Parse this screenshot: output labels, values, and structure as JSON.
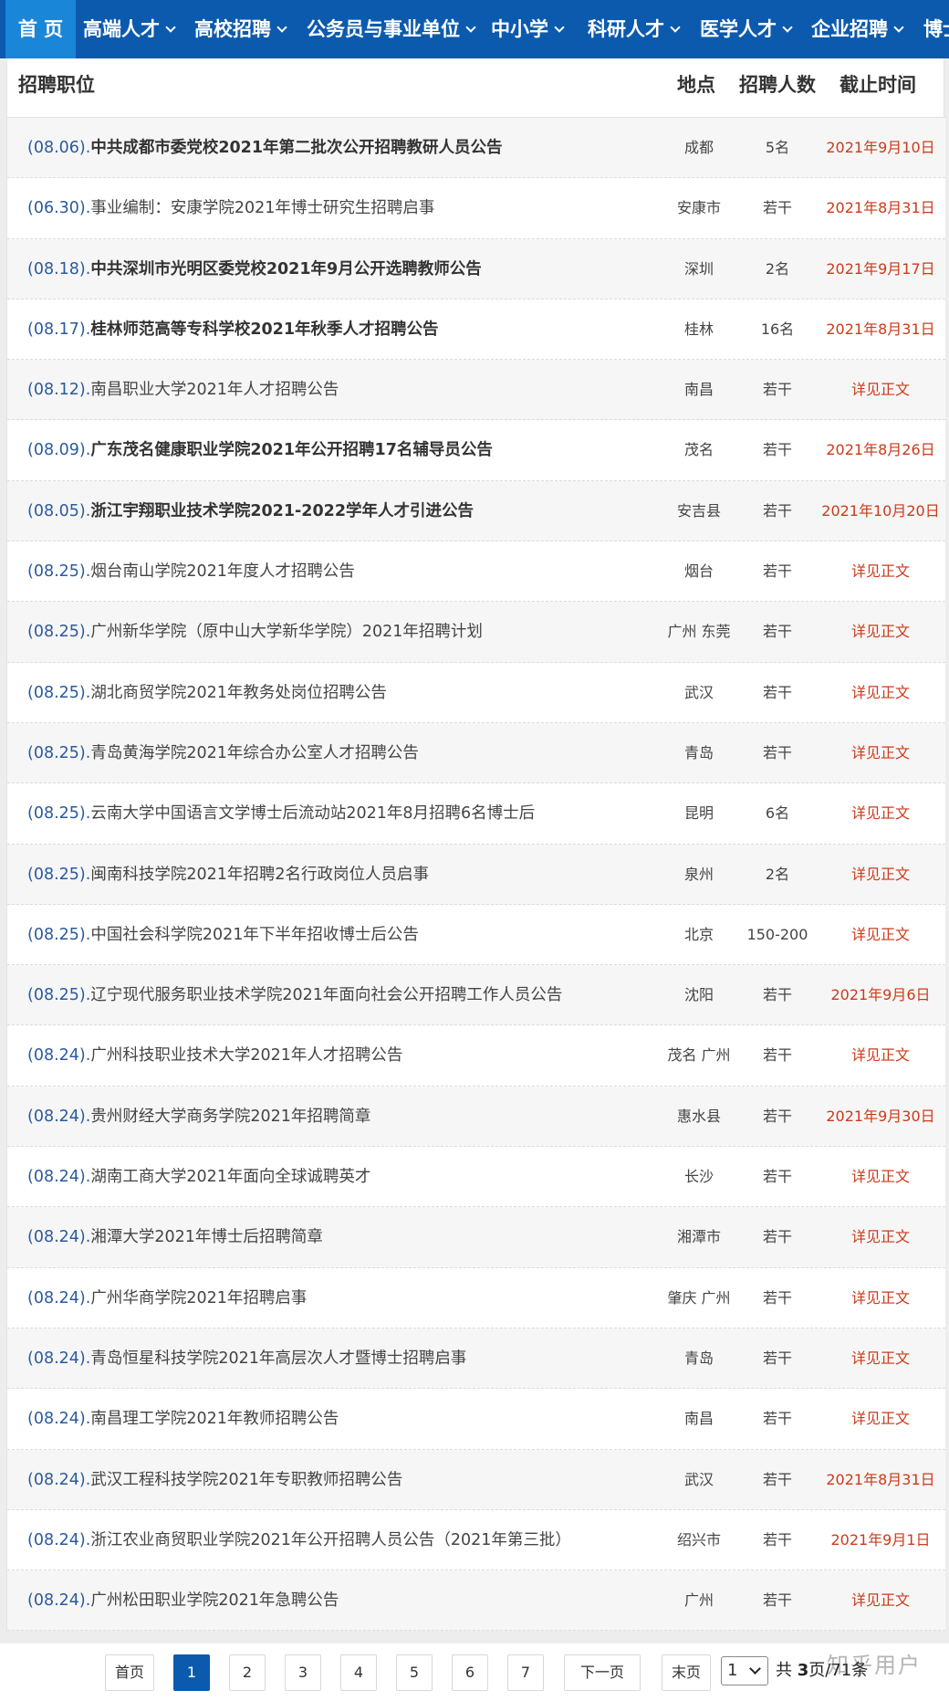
{
  "nav": {
    "items": [
      {
        "label": "首 页",
        "dropdown": false,
        "active": true
      },
      {
        "label": "高端人才",
        "dropdown": true
      },
      {
        "label": "高校招聘",
        "dropdown": true
      },
      {
        "label": "公务员与事业单位",
        "dropdown": true
      },
      {
        "label": "中小学",
        "dropdown": true
      },
      {
        "label": "科研人才",
        "dropdown": true
      },
      {
        "label": "医学人才",
        "dropdown": true
      },
      {
        "label": "企业招聘",
        "dropdown": true
      },
      {
        "label": "博士",
        "dropdown": false
      }
    ]
  },
  "table": {
    "headers": {
      "title": "招聘职位",
      "location": "地点",
      "count": "招聘人数",
      "deadline": "截止时间"
    },
    "rows": [
      {
        "date": "(08.06).",
        "title": "中共成都市委党校2021年第二批次公开招聘教研人员公告",
        "bold": true,
        "location": "成都",
        "count": "5名",
        "deadline": "2021年9月10日"
      },
      {
        "date": "(06.30).",
        "title": "事业编制：安康学院2021年博士研究生招聘启事",
        "bold": false,
        "location": "安康市",
        "count": "若干",
        "deadline": "2021年8月31日"
      },
      {
        "date": "(08.18).",
        "title": "中共深圳市光明区委党校2021年9月公开选聘教师公告",
        "bold": true,
        "location": "深圳",
        "count": "2名",
        "deadline": "2021年9月17日"
      },
      {
        "date": "(08.17).",
        "title": "桂林师范高等专科学校2021年秋季人才招聘公告",
        "bold": true,
        "location": "桂林",
        "count": "16名",
        "deadline": "2021年8月31日"
      },
      {
        "date": "(08.12).",
        "title": "南昌职业大学2021年人才招聘公告",
        "bold": false,
        "location": "南昌",
        "count": "若干",
        "deadline": "详见正文"
      },
      {
        "date": "(08.09).",
        "title": "广东茂名健康职业学院2021年公开招聘17名辅导员公告",
        "bold": true,
        "location": "茂名",
        "count": "若干",
        "deadline": "2021年8月26日"
      },
      {
        "date": "(08.05).",
        "title": "浙江宇翔职业技术学院2021-2022学年人才引进公告",
        "bold": true,
        "location": "安吉县",
        "count": "若干",
        "deadline": "2021年10月20日"
      },
      {
        "date": "(08.25).",
        "title": "烟台南山学院2021年度人才招聘公告",
        "bold": false,
        "location": "烟台",
        "count": "若干",
        "deadline": "详见正文"
      },
      {
        "date": "(08.25).",
        "title": "广州新华学院（原中山大学新华学院）2021年招聘计划",
        "bold": false,
        "location": "广州 东莞",
        "count": "若干",
        "deadline": "详见正文"
      },
      {
        "date": "(08.25).",
        "title": "湖北商贸学院2021年教务处岗位招聘公告",
        "bold": false,
        "location": "武汉",
        "count": "若干",
        "deadline": "详见正文"
      },
      {
        "date": "(08.25).",
        "title": "青岛黄海学院2021年综合办公室人才招聘公告",
        "bold": false,
        "location": "青岛",
        "count": "若干",
        "deadline": "详见正文"
      },
      {
        "date": "(08.25).",
        "title": "云南大学中国语言文学博士后流动站2021年8月招聘6名博士后",
        "bold": false,
        "location": "昆明",
        "count": "6名",
        "deadline": "详见正文"
      },
      {
        "date": "(08.25).",
        "title": "闽南科技学院2021年招聘2名行政岗位人员启事",
        "bold": false,
        "location": "泉州",
        "count": "2名",
        "deadline": "详见正文"
      },
      {
        "date": "(08.25).",
        "title": "中国社会科学院2021年下半年招收博士后公告",
        "bold": false,
        "location": "北京",
        "count": "150-200",
        "deadline": "详见正文"
      },
      {
        "date": "(08.25).",
        "title": "辽宁现代服务职业技术学院2021年面向社会公开招聘工作人员公告",
        "bold": false,
        "location": "沈阳",
        "count": "若干",
        "deadline": "2021年9月6日"
      },
      {
        "date": "(08.24).",
        "title": "广州科技职业技术大学2021年人才招聘公告",
        "bold": false,
        "location": "茂名 广州",
        "count": "若干",
        "deadline": "详见正文"
      },
      {
        "date": "(08.24).",
        "title": "贵州财经大学商务学院2021年招聘简章",
        "bold": false,
        "location": "惠水县",
        "count": "若干",
        "deadline": "2021年9月30日"
      },
      {
        "date": "(08.24).",
        "title": "湖南工商大学2021年面向全球诚聘英才",
        "bold": false,
        "location": "长沙",
        "count": "若干",
        "deadline": "详见正文"
      },
      {
        "date": "(08.24).",
        "title": "湘潭大学2021年博士后招聘简章",
        "bold": false,
        "location": "湘潭市",
        "count": "若干",
        "deadline": "详见正文"
      },
      {
        "date": "(08.24).",
        "title": "广州华商学院2021年招聘启事",
        "bold": false,
        "location": "肇庆 广州",
        "count": "若干",
        "deadline": "详见正文"
      },
      {
        "date": "(08.24).",
        "title": "青岛恒星科技学院2021年高层次人才暨博士招聘启事",
        "bold": false,
        "location": "青岛",
        "count": "若干",
        "deadline": "详见正文"
      },
      {
        "date": "(08.24).",
        "title": "南昌理工学院2021年教师招聘公告",
        "bold": false,
        "location": "南昌",
        "count": "若干",
        "deadline": "详见正文"
      },
      {
        "date": "(08.24).",
        "title": "武汉工程科技学院2021年专职教师招聘公告",
        "bold": false,
        "location": "武汉",
        "count": "若干",
        "deadline": "2021年8月31日"
      },
      {
        "date": "(08.24).",
        "title": "浙江农业商贸职业学院2021年公开招聘人员公告（2021年第三批）",
        "bold": false,
        "location": "绍兴市",
        "count": "若干",
        "deadline": "2021年9月1日"
      },
      {
        "date": "(08.24).",
        "title": "广州松田职业学院2021年急聘公告",
        "bold": false,
        "location": "广州",
        "count": "若干",
        "deadline": "详见正文"
      }
    ]
  },
  "pagination": {
    "first": "首页",
    "pages": [
      "1",
      "2",
      "3",
      "4",
      "5",
      "6",
      "7"
    ],
    "current": "1",
    "next": "下一页",
    "last": "末页",
    "select_value": "1",
    "total_prefix": "共 ",
    "total_value": "3",
    "total_suffix": "页/71条"
  },
  "watermark": "知乎用户",
  "colors": {
    "nav_bg": "#0c5aad",
    "nav_active": "#1a86d8",
    "date_text": "#2a5a9e",
    "deadline_text": "#cc3a1a"
  }
}
